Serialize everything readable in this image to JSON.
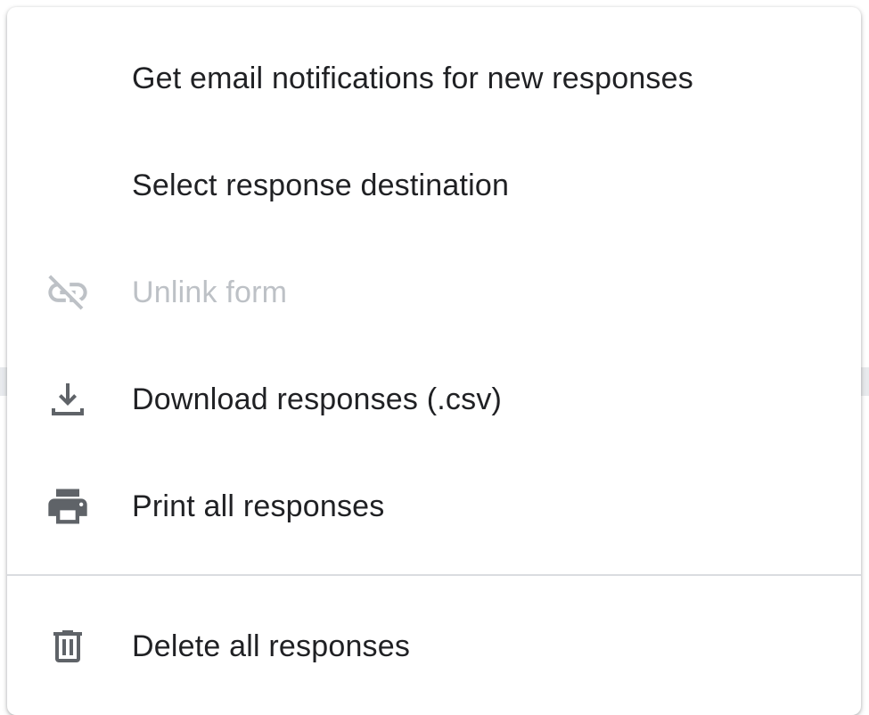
{
  "menu": {
    "items": [
      {
        "label": "Get email notifications for new responses",
        "icon": null,
        "disabled": false
      },
      {
        "label": "Select response destination",
        "icon": null,
        "disabled": false
      },
      {
        "label": "Unlink form",
        "icon": "link-off-icon",
        "disabled": true
      },
      {
        "label": "Download responses (.csv)",
        "icon": "download-icon",
        "disabled": false
      },
      {
        "label": "Print all responses",
        "icon": "print-icon",
        "disabled": false
      },
      {
        "label": "Delete all responses",
        "icon": "trash-icon",
        "disabled": false
      }
    ]
  },
  "colors": {
    "text": "#202124",
    "disabled_text": "#bdc1c6",
    "icon": "#5f6368",
    "disabled_icon": "#bdc1c6",
    "divider": "#dadce0"
  }
}
